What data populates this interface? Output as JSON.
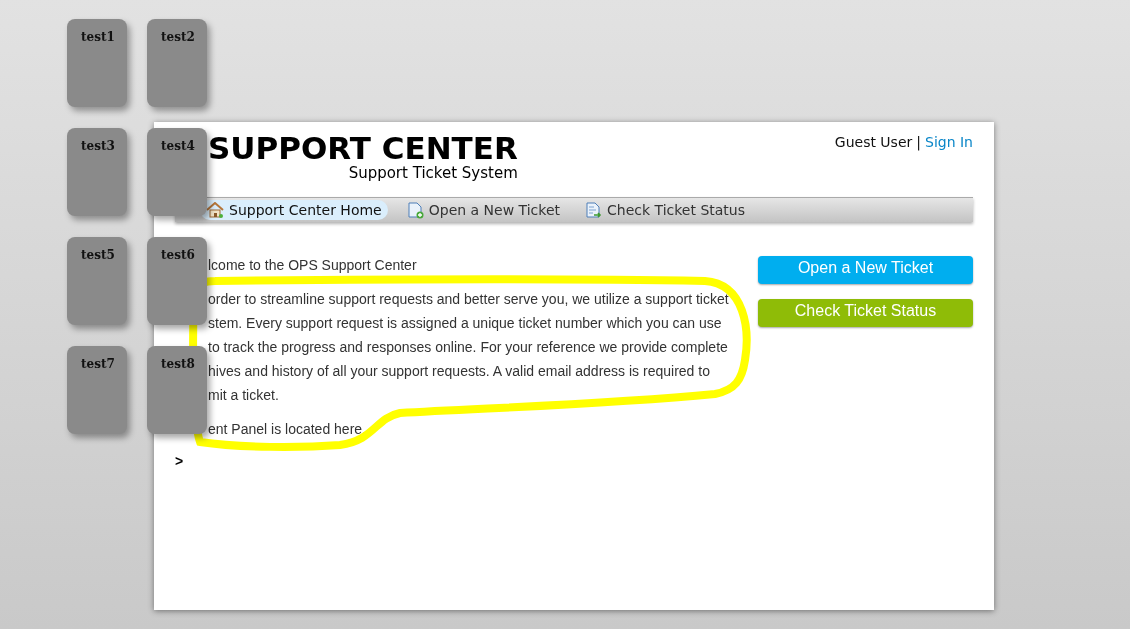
{
  "tiles": [
    {
      "label": "test1"
    },
    {
      "label": "test2"
    },
    {
      "label": "test3"
    },
    {
      "label": "test4"
    },
    {
      "label": "test5"
    },
    {
      "label": "test6"
    },
    {
      "label": "test7"
    },
    {
      "label": "test8"
    }
  ],
  "header": {
    "title": "SUPPORT CENTER",
    "subtitle": "Support Ticket System",
    "user": "Guest User",
    "separator": "|",
    "sign_in": "Sign In"
  },
  "nav": [
    {
      "label": "Support Center Home",
      "kind": "home",
      "selected": true
    },
    {
      "label": "Open a New Ticket",
      "kind": "new",
      "selected": false
    },
    {
      "label": "Check Ticket Status",
      "kind": "status",
      "selected": false
    }
  ],
  "content": {
    "heading": "lcome to the OPS Support Center",
    "lines": [
      "order to streamline support requests and better serve you, we utilize a support ticket",
      "stem. Every support request is assigned a unique ticket number which you can use",
      "to track the progress and responses online. For your reference we provide complete",
      "hives and history of all your support requests. A valid email address is required to",
      "mit a ticket."
    ],
    "note": "ent Panel is located here.",
    "caret": ">"
  },
  "actions": [
    {
      "label": "Open a New Ticket",
      "color": "#00aeef"
    },
    {
      "label": "Check Ticket Status",
      "color": "#8fbc07"
    }
  ]
}
